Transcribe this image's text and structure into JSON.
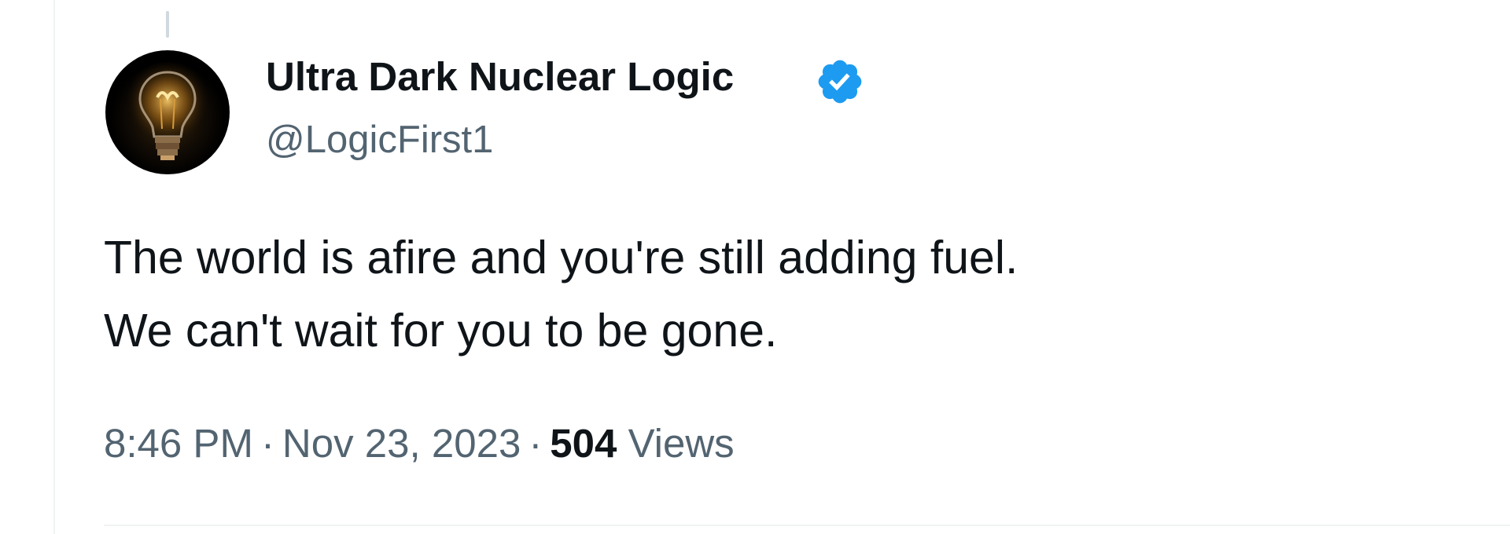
{
  "tweet": {
    "author": {
      "display_name": "Ultra Dark Nuclear Logic",
      "handle": "@LogicFirst1",
      "verified": true,
      "verified_icon": "verified-badge-icon",
      "avatar_icon": "light-bulb-avatar"
    },
    "text_lines": [
      "The world is afire and you're still adding fuel.",
      "We can't wait for you to be gone."
    ],
    "meta": {
      "time": "8:46 PM",
      "separator": "·",
      "date": "Nov 23, 2023",
      "views_count": "504",
      "views_label": "Views"
    }
  },
  "colors": {
    "primary_text": "#0f1419",
    "secondary_text": "#536471",
    "verified_blue": "#1d9bf0",
    "divider": "#eff3f4"
  }
}
